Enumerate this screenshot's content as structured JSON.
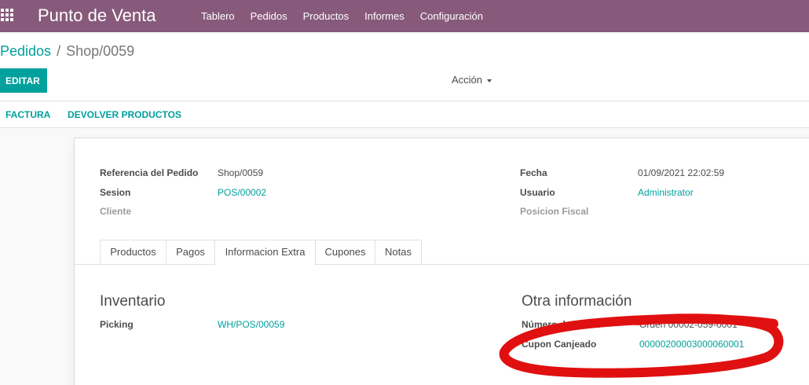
{
  "navbar": {
    "brand": "Punto de Venta",
    "menu": [
      "Tablero",
      "Pedidos",
      "Productos",
      "Informes",
      "Configuración"
    ]
  },
  "breadcrumb": {
    "parent": "Pedidos",
    "separator": "/",
    "current": "Shop/0059"
  },
  "buttons": {
    "edit": "EDITAR",
    "action": "Acción"
  },
  "statusbar": {
    "invoice": "FACTURA",
    "return_products": "DEVOLVER PRODUCTOS"
  },
  "form": {
    "left": [
      {
        "label": "Referencia del Pedido",
        "value": "Shop/0059"
      },
      {
        "label": "Sesion",
        "value": "POS/00002"
      },
      {
        "label": "Cliente",
        "value": ""
      }
    ],
    "right": [
      {
        "label": "Fecha",
        "value": "01/09/2021 22:02:59"
      },
      {
        "label": "Usuario",
        "value": "Administrator"
      },
      {
        "label": "Posicion Fiscal",
        "value": ""
      }
    ]
  },
  "tabs": [
    "Productos",
    "Pagos",
    "Informacion Extra",
    "Cupones",
    "Notas"
  ],
  "active_tab": "Informacion Extra",
  "inventory": {
    "title": "Inventario",
    "picking_label": "Picking",
    "picking_value": "WH/POS/00059"
  },
  "other_info": {
    "title": "Otra información",
    "receipt_label": "Número de recibo",
    "receipt_value": "Orden 00002-059-0001",
    "coupon_label": "Cupon Canjeado",
    "coupon_value": "00000200003000060001"
  },
  "colors": {
    "navbar": "#875a7b",
    "accent": "#00a09d",
    "annotation": "#e01010"
  }
}
